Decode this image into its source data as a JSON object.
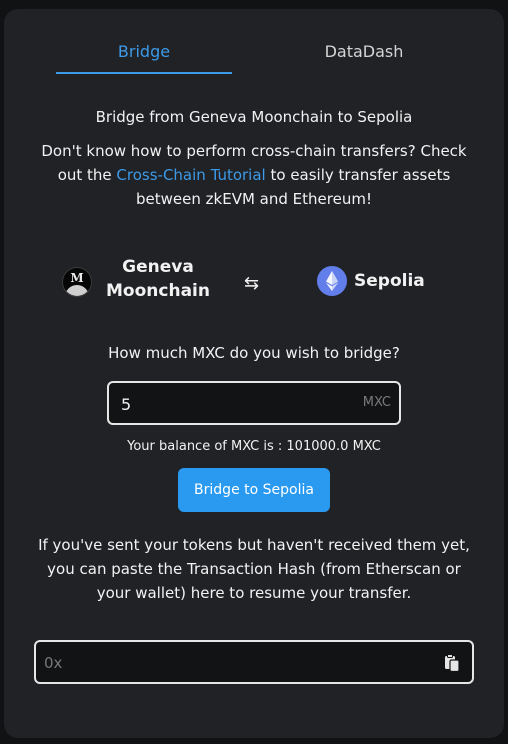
{
  "tabs": [
    {
      "label": "Bridge",
      "active": true
    },
    {
      "label": "DataDash",
      "active": false
    }
  ],
  "route_title": "Bridge from Geneva Moonchain to Sepolia",
  "intro": {
    "before_link": "Don't know how to perform cross-chain transfers? Check out the ",
    "link_text": "Cross-Chain Tutorial",
    "after_link": " to easily transfer assets between zkEVM and Ethereum!"
  },
  "chains": {
    "from": {
      "name": "Geneva Moonchain",
      "icon": "moonchain-logo-icon"
    },
    "swap_icon": "⇆",
    "to": {
      "name": "Sepolia",
      "icon": "ethereum-logo-icon"
    }
  },
  "amount": {
    "question": "How much MXC do you wish to bridge?",
    "value": "5",
    "unit": "MXC"
  },
  "balance_text": "Your balance of MXC is : 101000.0 MXC",
  "bridge_button_label": "Bridge to Sepolia",
  "resume_text": "If you've sent your tokens but haven't received them yet, you can paste the Transaction Hash (from Etherscan or your wallet) here to resume your transfer.",
  "tx_hash": {
    "placeholder": "0x",
    "value": ""
  },
  "colors": {
    "accent": "#3c9ae8",
    "button": "#2a9af0",
    "card": "#212226",
    "background": "#111214"
  }
}
